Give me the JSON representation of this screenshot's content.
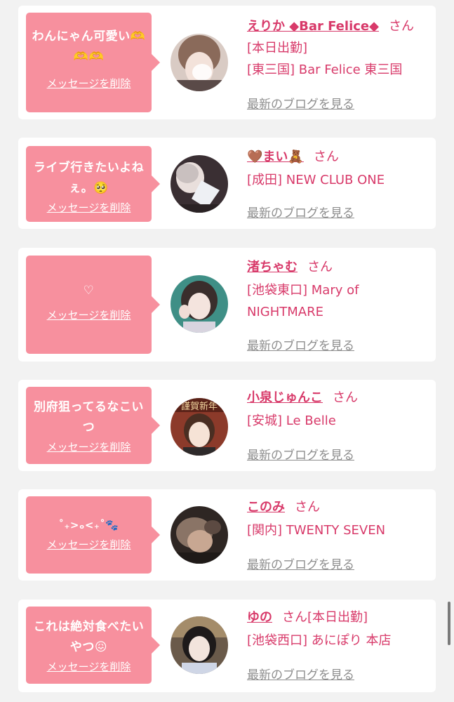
{
  "delete_label": "メッセージを削除",
  "blog_label": "最新のブログを見る",
  "honorific": "さん",
  "colors": {
    "bubble": "#f7909e",
    "accent": "#d83a6a",
    "muted": "#8e8e8e"
  },
  "entries": [
    {
      "message": "わんにゃん可愛い🫶🫶🫶",
      "name": "えりか ◆Bar Felice◆",
      "status": "[本日出勤]",
      "shop": "[東三国] Bar Felice 東三国"
    },
    {
      "message": "ライブ行きたいよねぇ。🥺",
      "name": "🤎まい🧸",
      "status": "",
      "shop": "[成田] NEW CLUB ONE"
    },
    {
      "message": "♡",
      "name": "渚ちゃむ",
      "status": "",
      "shop": "[池袋東口] Mary of NIGHTMARE"
    },
    {
      "message": "別府狙ってるなこいつ",
      "name": "小泉じゅんこ",
      "status": "",
      "shop": "[安城] Le Belle",
      "avatar_text": "謹賀新年"
    },
    {
      "message": "˚₊>ₒ<₊˚🐾",
      "name": "このみ",
      "status": "",
      "shop": "[関内] TWENTY SEVEN"
    },
    {
      "message": "これは絶対食べたいやつ😖",
      "name": "ゆの",
      "status": "[本日出勤]",
      "shop": "[池袋西口] あにぽり 本店"
    }
  ]
}
